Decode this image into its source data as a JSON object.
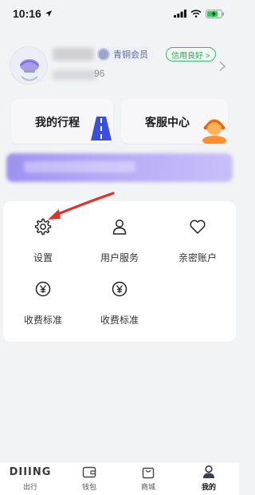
{
  "status_bar": {
    "time": "10:16",
    "icons": [
      "location-arrow-icon",
      "signal-icon",
      "wifi-icon",
      "battery-charging-icon"
    ]
  },
  "profile": {
    "avatar_icon": "avatar",
    "member_level": "青铜会员",
    "member_icon": "bronze-medal-icon",
    "credit_status": "信用良好 >",
    "phone_tail": "96",
    "chevron_icon": "chevron-right-icon"
  },
  "quick_cards": [
    {
      "label": "我的行程",
      "icon": "road-icon"
    },
    {
      "label": "客服中心",
      "icon": "customer-service-icon"
    }
  ],
  "menu": {
    "items": [
      {
        "label": "设置",
        "icon": "gear-icon"
      },
      {
        "label": "用户服务",
        "icon": "user-icon"
      },
      {
        "label": "亲密账户",
        "icon": "heart-icon"
      },
      {
        "label": "收费标准",
        "icon": "yuan-icon"
      },
      {
        "label": "收费标准",
        "icon": "yuan-icon"
      }
    ]
  },
  "bottom_nav": {
    "items": [
      {
        "label": "出行",
        "icon": "diling-logo",
        "logo_text": "DIIING"
      },
      {
        "label": "钱包",
        "icon": "wallet-icon"
      },
      {
        "label": "商城",
        "icon": "shopping-bag-icon"
      },
      {
        "label": "我的",
        "icon": "profile-icon",
        "active": true
      }
    ]
  },
  "colors": {
    "accent_green": "#2ea760",
    "member_blue": "#5a6a95",
    "arrow_red": "#e0312b",
    "banner_purple": "#b5a8f7"
  }
}
